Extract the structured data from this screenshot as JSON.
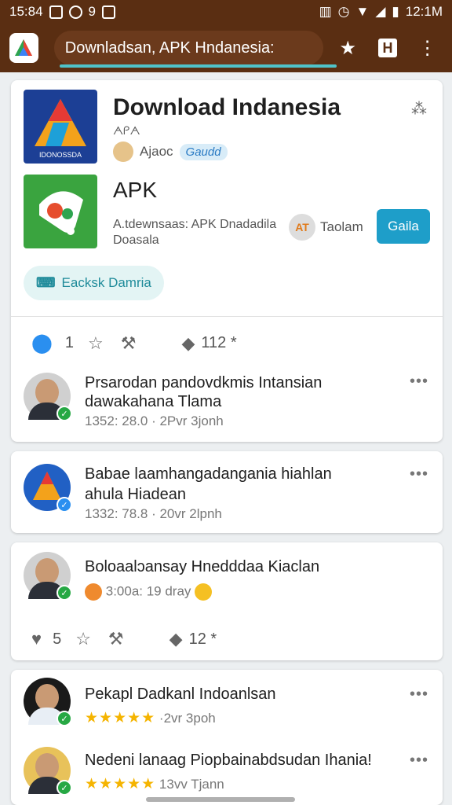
{
  "status_bar": {
    "time_left": "15:84",
    "time_right": "12:1M"
  },
  "browser": {
    "url": "Downladsan, APK Hndanesia:",
    "logo_icon": "triangle-logo-icon",
    "star_icon": "star-icon",
    "h_label": "H",
    "menu_icon": "more-vert-icon",
    "load_progress": 0.95
  },
  "app_card": {
    "title": "Download Indanesia",
    "icon_caption": "IDONOSSDA",
    "subtitle": "ᗅᑭᗅ",
    "author": "Ajaoc",
    "badge": "Gaudd",
    "title2": "APK",
    "description": "A.tdewnsaas: APK Dnadadila Doasala",
    "tag_label": "Taolam",
    "tag_icon_text": "AT",
    "open_button": "Gaila",
    "chip_label": "Eacksk Damria",
    "stats": {
      "location_count": "1",
      "comments_count": "112 *"
    }
  },
  "posts": [
    {
      "title_line1": "Prsarodan pandovdkmis Intansian",
      "title_line2": "dawakahana Tlama",
      "meta": "1352: 28.0 · 2Pvr 3jonh"
    },
    {
      "title_line1": "Babae laamhangadangania hiahlan",
      "title_line2": "ahula Hiadean",
      "meta": "1332: 78.8 · 20vr 2lpnh"
    },
    {
      "title_line1": "Boloaalɔansay Hnedddaa Kiaclan",
      "meta": "3:00a: 19 dray",
      "likes": "5",
      "comments": "12 *"
    },
    {
      "title_line1": "Pekapl Dadkanl Indoanlsan",
      "meta": "·2vr 3poh",
      "stars": "★★★★★"
    },
    {
      "title_line1": "Nedeni lanaag Piopbainabdsudan Ihania!",
      "meta": "13vv Tjann",
      "stars": "★★★★★"
    }
  ]
}
